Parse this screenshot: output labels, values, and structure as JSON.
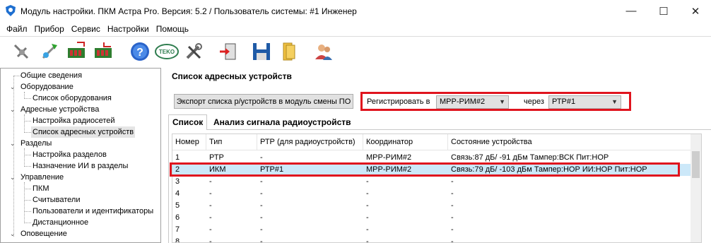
{
  "window": {
    "title": "Модуль настройки. ПКМ Астра Pro. Версия: 5.2 / Пользователь системы: #1 Инженер",
    "minimize": "—",
    "maximize": "☐",
    "close": "✕"
  },
  "menu": [
    "Файл",
    "Прибор",
    "Сервис",
    "Настройки",
    "Помощь"
  ],
  "toolbar": {
    "icons": [
      "disconnect-icon",
      "connect-icon",
      "read-device-icon",
      "write-device-icon",
      "help-icon",
      "teko-icon",
      "tools-icon",
      "exit-icon",
      "save-icon",
      "open-icon",
      "users-icon"
    ],
    "teko_label": "TEKO"
  },
  "tree": {
    "items": [
      {
        "label": "Общие сведения",
        "level": 0
      },
      {
        "label": "Оборудование",
        "level": 0,
        "expanded": true
      },
      {
        "label": "Список оборудования",
        "level": 1
      },
      {
        "label": "Адресные устройства",
        "level": 0,
        "expanded": true
      },
      {
        "label": "Настройка радиосетей",
        "level": 1
      },
      {
        "label": "Список адресных устройств",
        "level": 1,
        "selected": true
      },
      {
        "label": "Разделы",
        "level": 0,
        "expanded": true
      },
      {
        "label": "Настройка разделов",
        "level": 1
      },
      {
        "label": "Назначение ИИ в разделы",
        "level": 1
      },
      {
        "label": "Управление",
        "level": 0,
        "expanded": true
      },
      {
        "label": "ПКМ",
        "level": 1
      },
      {
        "label": "Считыватели",
        "level": 1
      },
      {
        "label": "Пользователи и идентификаторы",
        "level": 1
      },
      {
        "label": "Дистанционное",
        "level": 1
      },
      {
        "label": "Оповещение",
        "level": 0,
        "expanded": true
      }
    ]
  },
  "panel": {
    "title": "Список адресных устройств",
    "export_button": "Экспорт списка р/устройств в модуль смены ПО",
    "register_label": "Регистрировать в",
    "register_value": "МРР-РИМ#2",
    "via_label": "через",
    "via_value": "РТР#1"
  },
  "tabs": [
    {
      "label": "Список",
      "active": true
    },
    {
      "label": "Анализ сигнала радиоустройств",
      "active": false
    }
  ],
  "table": {
    "columns": [
      "Номер",
      "Тип",
      "РТР (для радиоустройств)",
      "Координатор",
      "Состояние устройства"
    ],
    "rows": [
      [
        "1",
        "РТР",
        "-",
        "МРР-РИМ#2",
        "Связь:87 дБ/ -91 дБм Тампер:ВСК Пит:НОР"
      ],
      [
        "2",
        "ИКМ",
        "РТР#1",
        "МРР-РИМ#2",
        "Связь:79 дБ/ -103 дБм Тампер:НОР ИИ:НОР Пит:НОР"
      ],
      [
        "3",
        "-",
        "-",
        "-",
        "-"
      ],
      [
        "4",
        "-",
        "-",
        "-",
        "-"
      ],
      [
        "5",
        "-",
        "-",
        "-",
        "-"
      ],
      [
        "6",
        "-",
        "-",
        "-",
        "-"
      ],
      [
        "7",
        "-",
        "-",
        "-",
        "-"
      ],
      [
        "8",
        "-",
        "-",
        "-",
        "-"
      ]
    ],
    "selected_row": 1
  },
  "colors": {
    "highlight_border": "#e0141e",
    "selected_row": "#cce8f9"
  }
}
